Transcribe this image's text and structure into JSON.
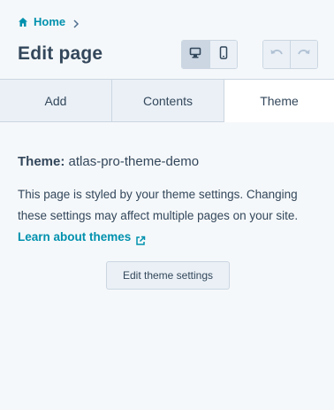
{
  "breadcrumb": {
    "home_label": "Home",
    "home_icon": "home-icon",
    "separator_icon": "chevron-right-icon"
  },
  "header": {
    "title": "Edit page"
  },
  "view_toggle": {
    "desktop_icon": "desktop-icon",
    "mobile_icon": "mobile-icon",
    "active": "desktop"
  },
  "history": {
    "undo_icon": "undo-icon",
    "redo_icon": "redo-icon"
  },
  "tabs": [
    {
      "label": "Add",
      "active": false
    },
    {
      "label": "Contents",
      "active": false
    },
    {
      "label": "Theme",
      "active": true
    }
  ],
  "theme_panel": {
    "theme_label": "Theme:",
    "theme_name": "atlas-pro-theme-demo",
    "description": "This page is styled by your theme settings. Changing these settings may affect multiple pages on your site.",
    "learn_link": "Learn about themes",
    "link_icon": "external-link-icon",
    "settings_button": "Edit theme settings"
  },
  "colors": {
    "link": "#0091ae",
    "text": "#33475b",
    "border": "#cbd6e2",
    "background": "#f5f8fa"
  }
}
